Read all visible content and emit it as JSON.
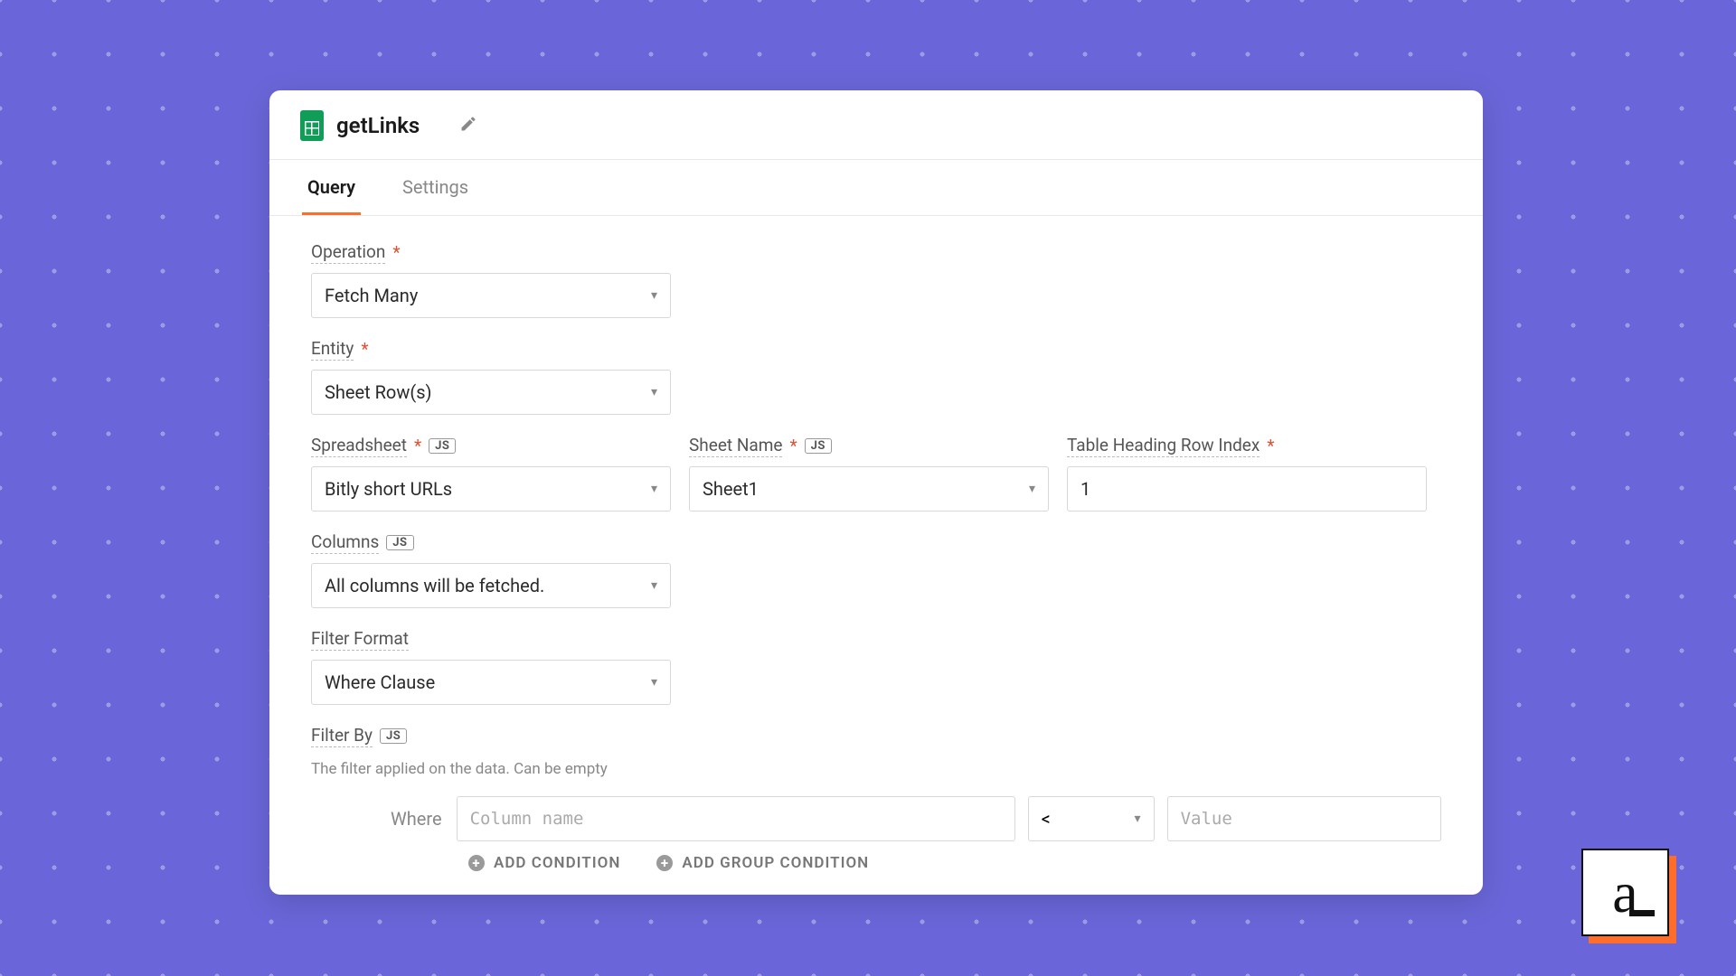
{
  "header": {
    "title": "getLinks"
  },
  "tabs": {
    "query": "Query",
    "settings": "Settings"
  },
  "fields": {
    "operation": {
      "label": "Operation",
      "value": "Fetch Many"
    },
    "entity": {
      "label": "Entity",
      "value": "Sheet Row(s)"
    },
    "spreadsheet": {
      "label": "Spreadsheet",
      "value": "Bitly short URLs"
    },
    "sheetName": {
      "label": "Sheet Name",
      "value": "Sheet1"
    },
    "headingRow": {
      "label": "Table Heading Row Index",
      "value": "1"
    },
    "columns": {
      "label": "Columns",
      "value": "All columns will be fetched."
    },
    "filterFormat": {
      "label": "Filter Format",
      "value": "Where Clause"
    },
    "filterBy": {
      "label": "Filter By",
      "hint": "The filter applied on the data. Can be empty"
    }
  },
  "filterRow": {
    "whereLabel": "Where",
    "columnPlaceholder": "Column name",
    "operator": "<",
    "valuePlaceholder": "Value"
  },
  "buttons": {
    "addCondition": "ADD CONDITION",
    "addGroupCondition": "ADD GROUP CONDITION"
  },
  "badges": {
    "js": "JS"
  },
  "brand": {
    "letter": "a"
  }
}
